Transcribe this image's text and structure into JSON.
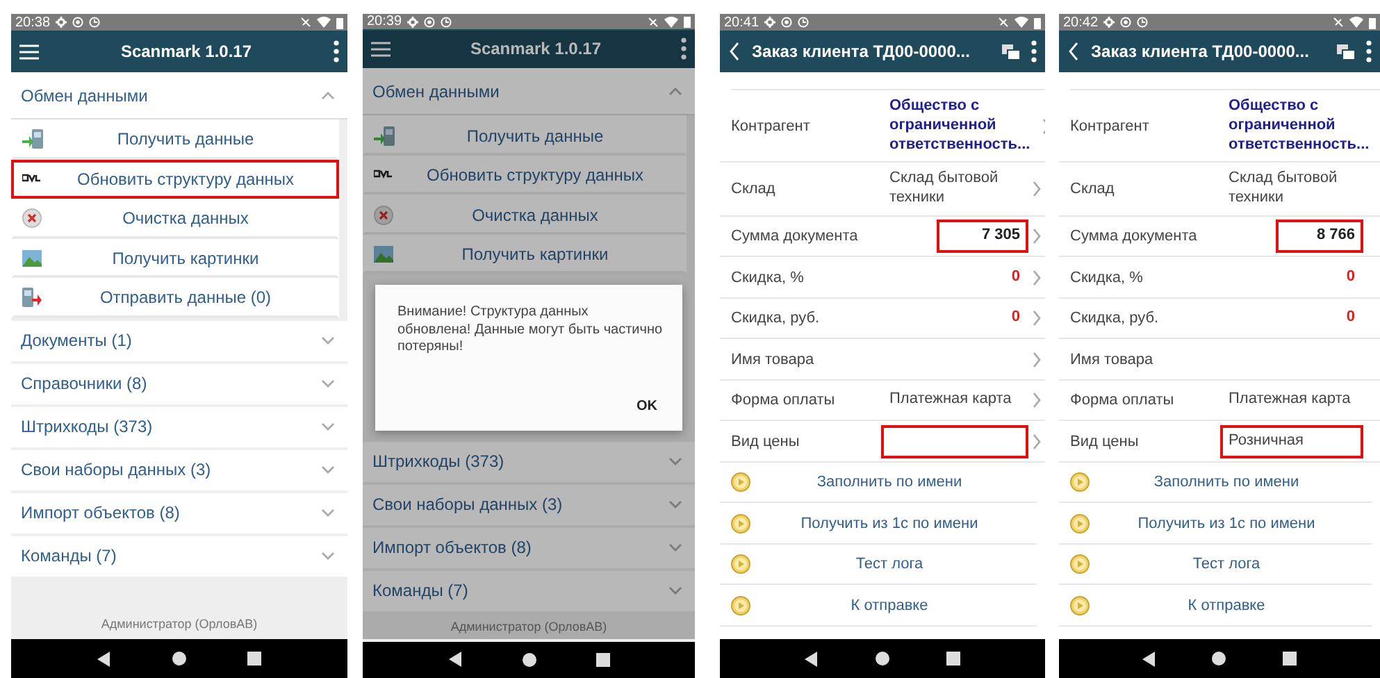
{
  "screens": [
    {
      "kind": "menu",
      "status_time": "20:38",
      "title": "Scanmark 1.0.17",
      "exchange": {
        "label": "Обмен данными",
        "expanded": true,
        "items": [
          {
            "label": "Получить данные",
            "kind": "receive",
            "highlighted": false
          },
          {
            "label": "Обновить структуру данных",
            "kind": "update",
            "highlighted": true
          },
          {
            "label": "Очистка данных",
            "kind": "clear",
            "highlighted": false
          },
          {
            "label": "Получить картинки",
            "kind": "pictures",
            "highlighted": false
          },
          {
            "label": "Отправить данные (0)",
            "kind": "send",
            "highlighted": false
          }
        ]
      },
      "sections": [
        {
          "label": "Документы (1)",
          "expanded": false
        },
        {
          "label": "Справочники (8)",
          "expanded": false
        },
        {
          "label": "Штрихкоды (373)",
          "expanded": false
        },
        {
          "label": "Свои наборы данных (3)",
          "expanded": false
        },
        {
          "label": "Импорт объектов (8)",
          "expanded": false
        },
        {
          "label": "Команды (7)",
          "expanded": false
        }
      ],
      "footer": "Администратор (ОрловАВ)"
    },
    {
      "kind": "menu",
      "status_time": "20:39",
      "title": "Scanmark 1.0.17",
      "exchange": {
        "label": "Обмен данными",
        "expanded": true,
        "items": [
          {
            "label": "Получить данные",
            "kind": "receive",
            "highlighted": false
          },
          {
            "label": "Обновить структуру данных",
            "kind": "update",
            "highlighted": false
          },
          {
            "label": "Очистка данных",
            "kind": "clear",
            "highlighted": false
          },
          {
            "label": "Получить картинки",
            "kind": "pictures",
            "highlighted": false
          }
        ]
      },
      "dialog": {
        "message": "Внимание! Структура данных обновлена! Данные могут быть частично потеряны!",
        "button": "OK"
      },
      "sections": [
        {
          "label": "Штрихкоды (373)",
          "expanded": false
        },
        {
          "label": "Свои наборы данных (3)",
          "expanded": false
        },
        {
          "label": "Импорт объектов (8)",
          "expanded": false
        },
        {
          "label": "Команды (7)",
          "expanded": false
        }
      ],
      "footer": "Администратор (ОрловАВ)"
    },
    {
      "kind": "form",
      "status_time": "20:41",
      "title": "Заказ клиента ТД00-0000...",
      "chevrons": true,
      "fields": [
        {
          "label": "Контрагент",
          "value": "Общество с ограниченной ответственность...",
          "kind": "link",
          "highlighted": false
        },
        {
          "label": "Склад",
          "value": "Склад бытовой техники",
          "kind": "text",
          "highlighted": false
        },
        {
          "label": "Сумма документа",
          "value": "7 305",
          "kind": "amount",
          "highlighted": true
        },
        {
          "label": "Скидка, %",
          "value": "0",
          "kind": "discount",
          "highlighted": false
        },
        {
          "label": "Скидка, руб.",
          "value": "0",
          "kind": "discount",
          "highlighted": false
        },
        {
          "label": "Имя товара",
          "kind": "text",
          "highlighted": false
        },
        {
          "label": "Форма оплаты",
          "value": "Платежная карта",
          "kind": "text",
          "highlighted": false
        },
        {
          "label": "Вид цены",
          "kind": "text",
          "highlighted": true
        }
      ],
      "actions": [
        "Заполнить по имени",
        "Получить из 1с по имени",
        "Тест лога",
        "К отправке"
      ]
    },
    {
      "kind": "form",
      "status_time": "20:42",
      "title": "Заказ клиента ТД00-0000...",
      "chevrons": false,
      "fields": [
        {
          "label": "Контрагент",
          "value": "Общество с ограниченной ответственность...",
          "kind": "link",
          "highlighted": false
        },
        {
          "label": "Склад",
          "value": "Склад бытовой техники",
          "kind": "text",
          "highlighted": false
        },
        {
          "label": "Сумма документа",
          "value": "8 766",
          "kind": "amount",
          "highlighted": true
        },
        {
          "label": "Скидка, %",
          "value": "0",
          "kind": "discount",
          "highlighted": false
        },
        {
          "label": "Скидка, руб.",
          "value": "0",
          "kind": "discount",
          "highlighted": false
        },
        {
          "label": "Имя товара",
          "kind": "text",
          "highlighted": false
        },
        {
          "label": "Форма оплаты",
          "value": "Платежная карта",
          "kind": "text",
          "highlighted": false
        },
        {
          "label": "Вид цены",
          "value": "Розничная",
          "kind": "text",
          "highlighted": true
        }
      ],
      "actions": [
        "Заполнить по имени",
        "Получить из 1с по имени",
        "Тест лога",
        "К отправке"
      ]
    }
  ]
}
